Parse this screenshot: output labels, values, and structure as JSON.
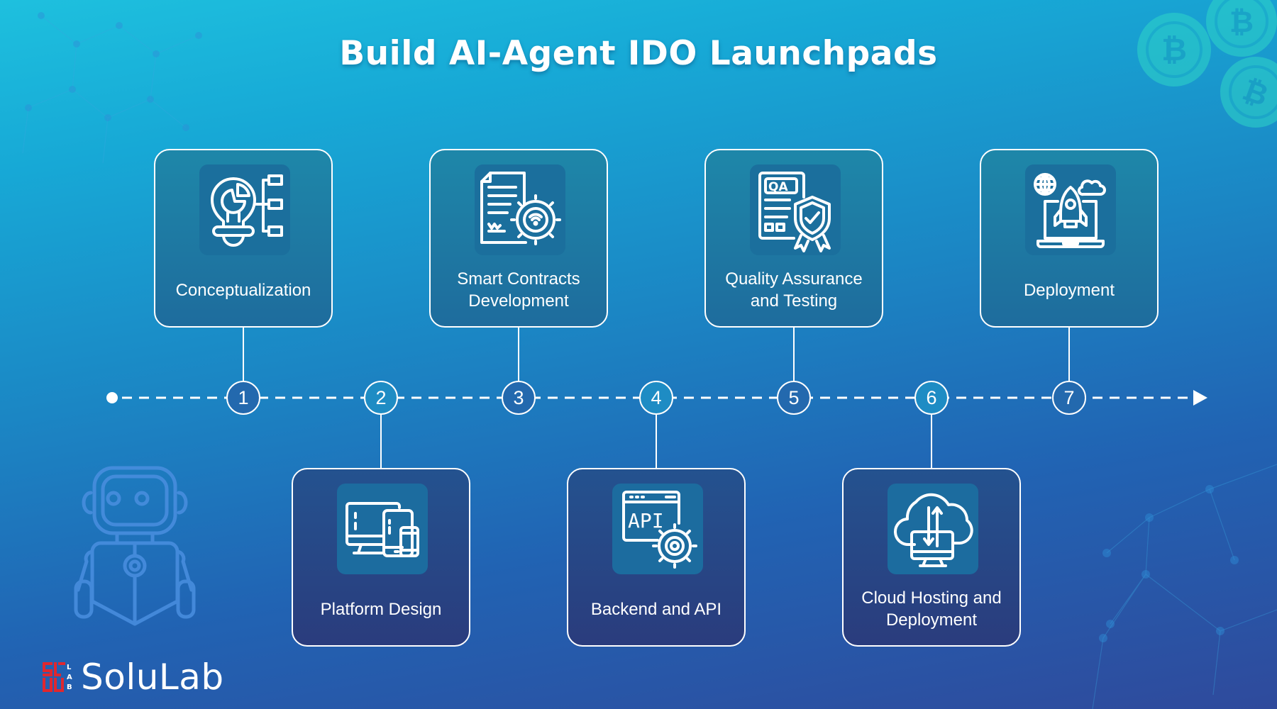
{
  "title": "Build AI-Agent IDO Launchpads",
  "colors": {
    "background_top": "#1ec0de",
    "background_bottom": "#2f4a9c",
    "card_top_fill": "#1e7ba3",
    "card_bottom_fill": "#274884",
    "circle_odd": "#2369ae",
    "circle_even": "#1e8cc4",
    "line": "#ffffff",
    "logo_red": "#e0272f"
  },
  "steps": [
    {
      "number": "1",
      "label": "Conceptualization",
      "icon": "lightbulb-chart-icon",
      "position": "top"
    },
    {
      "number": "2",
      "label": "Platform Design",
      "icon": "multi-device-icon",
      "position": "bottom"
    },
    {
      "number": "3",
      "label": "Smart Contracts Development",
      "icon": "contract-gear-icon",
      "position": "top"
    },
    {
      "number": "4",
      "label": "Backend and API",
      "icon": "api-gear-icon",
      "position": "bottom"
    },
    {
      "number": "5",
      "label": "Quality Assurance and Testing",
      "icon": "qa-shield-icon",
      "position": "top"
    },
    {
      "number": "6",
      "label": "Cloud Hosting and Deployment",
      "icon": "cloud-monitor-icon",
      "position": "bottom"
    },
    {
      "number": "7",
      "label": "Deployment",
      "icon": "rocket-laptop-icon",
      "position": "top"
    }
  ],
  "decorations": {
    "robot": "robot-icon",
    "coins": "bitcoin-coin-icon"
  },
  "logo": {
    "text": "SoluLab",
    "mark": "solulab-logo-mark"
  }
}
